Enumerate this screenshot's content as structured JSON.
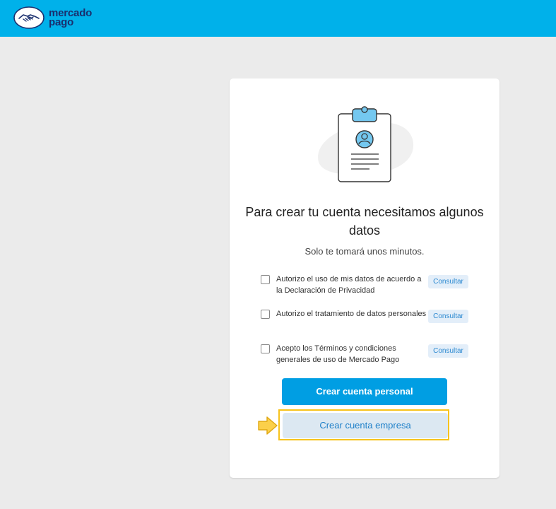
{
  "header": {
    "logo_line1": "mercado",
    "logo_line2": "pago",
    "logo_icon": "handshake-icon",
    "background": "#00b1ea"
  },
  "card": {
    "illustration_icon": "clipboard-profile-icon",
    "title": "Para crear tu cuenta necesitamos algunos datos",
    "subtitle": "Solo te tomará unos minutos.",
    "consents": [
      {
        "text": "Autorizo el uso de mis datos de acuerdo a la Declaración de Privacidad",
        "button": "Consultar",
        "checked": false
      },
      {
        "text": "Autorizo el tratamiento de datos personales",
        "button": "Consultar",
        "checked": false
      },
      {
        "text": "Acepto los Términos y condiciones generales de uso de Mercado Pago",
        "button": "Consultar",
        "checked": false
      }
    ],
    "primary_button": "Crear cuenta personal",
    "secondary_button": "Crear cuenta empresa"
  },
  "annotation": {
    "arrow_icon": "pointer-arrow-icon",
    "highlight_color": "#f7c31c"
  },
  "colors": {
    "accent": "#009ee3",
    "page_background": "#ebebeb"
  }
}
